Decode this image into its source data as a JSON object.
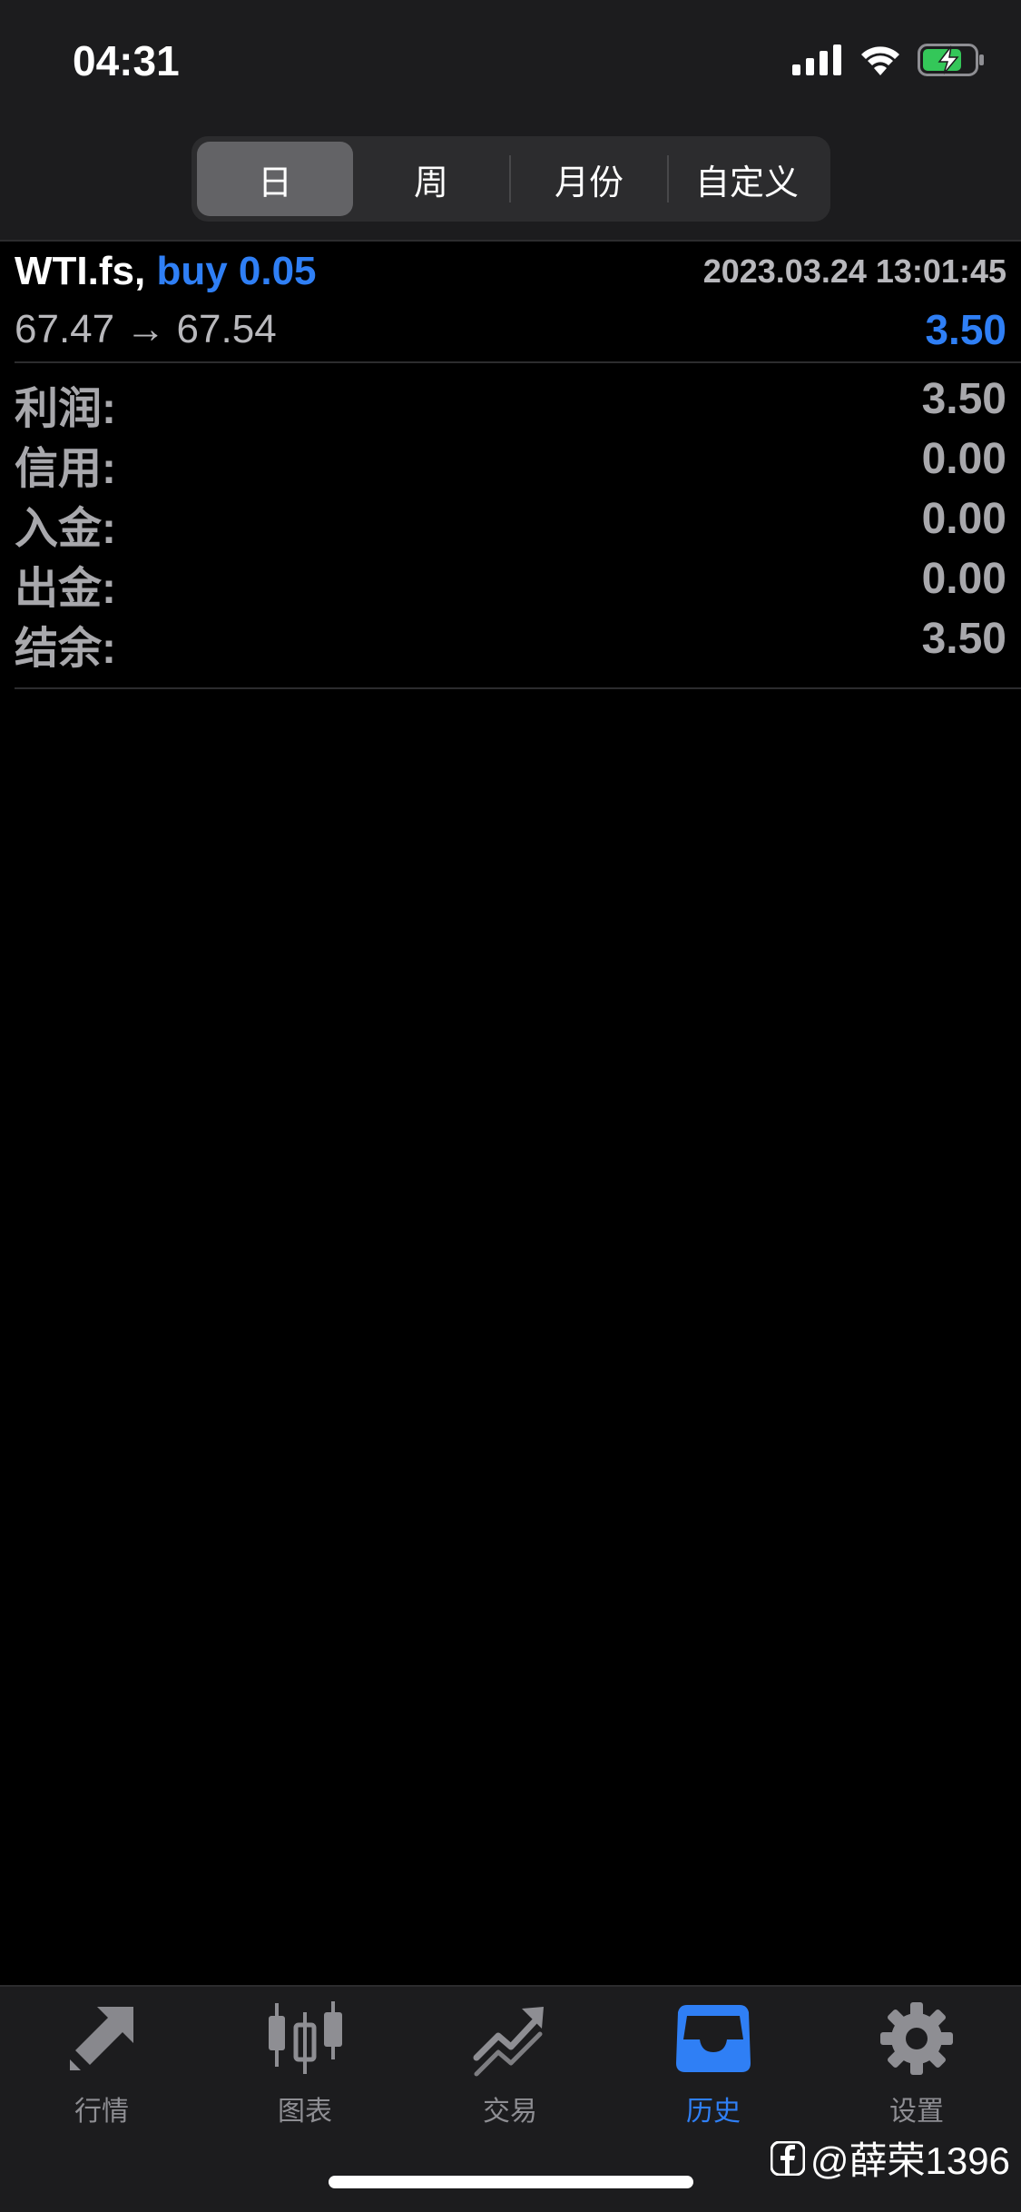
{
  "status_bar": {
    "time": "04:31"
  },
  "segments": [
    {
      "label": "日",
      "active": true
    },
    {
      "label": "周",
      "active": false
    },
    {
      "label": "月份",
      "active": false
    },
    {
      "label": "自定义",
      "active": false
    }
  ],
  "trade": {
    "symbol": "WTI.fs,",
    "side": "buy 0.05",
    "datetime": "2023.03.24 13:01:45",
    "prices": "67.47 → 67.54",
    "profit": "3.50"
  },
  "summary": [
    {
      "label": "利润:",
      "value": "3.50"
    },
    {
      "label": "信用:",
      "value": "0.00"
    },
    {
      "label": "入金:",
      "value": "0.00"
    },
    {
      "label": "出金:",
      "value": "0.00"
    },
    {
      "label": "结余:",
      "value": "3.50"
    }
  ],
  "tabs": [
    {
      "label": "行情",
      "icon": "quotes-arrows-icon",
      "active": false
    },
    {
      "label": "图表",
      "icon": "candlestick-icon",
      "active": false
    },
    {
      "label": "交易",
      "icon": "trade-trend-icon",
      "active": false
    },
    {
      "label": "历史",
      "icon": "history-tray-icon",
      "active": true
    },
    {
      "label": "设置",
      "icon": "gear-icon",
      "active": false
    }
  ],
  "watermark": {
    "text": "@薛荣1396"
  },
  "colors": {
    "accent": "#2f7ff5",
    "muted": "#a8a8ac",
    "bar_bg": "#1c1c1e"
  }
}
